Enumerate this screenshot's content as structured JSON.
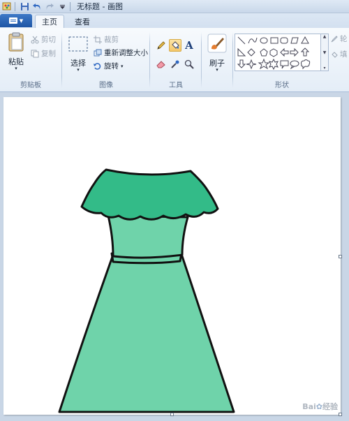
{
  "window": {
    "title": "无标题 - 画图"
  },
  "tabs": {
    "home": "主页",
    "view": "查看"
  },
  "clipboard": {
    "paste": "粘贴",
    "cut": "剪切",
    "copy": "复制",
    "group_label": "剪贴板"
  },
  "image": {
    "select": "选择",
    "crop": "裁剪",
    "resize": "重新调整大小",
    "rotate": "旋转",
    "group_label": "图像"
  },
  "tools": {
    "group_label": "工具",
    "text_glyph": "A",
    "active_tool": "fill-icon"
  },
  "brushes": {
    "label": "刷子"
  },
  "shapes": {
    "group_label": "形状",
    "outline_items": [
      "轮",
      "填"
    ]
  },
  "canvas": {
    "drawing": "green-dress",
    "colors": {
      "outline": "#111111",
      "top": "#33bb88",
      "body": "#6fd3aa"
    }
  },
  "watermark": {
    "text": "Bai",
    "text2": "经验"
  }
}
